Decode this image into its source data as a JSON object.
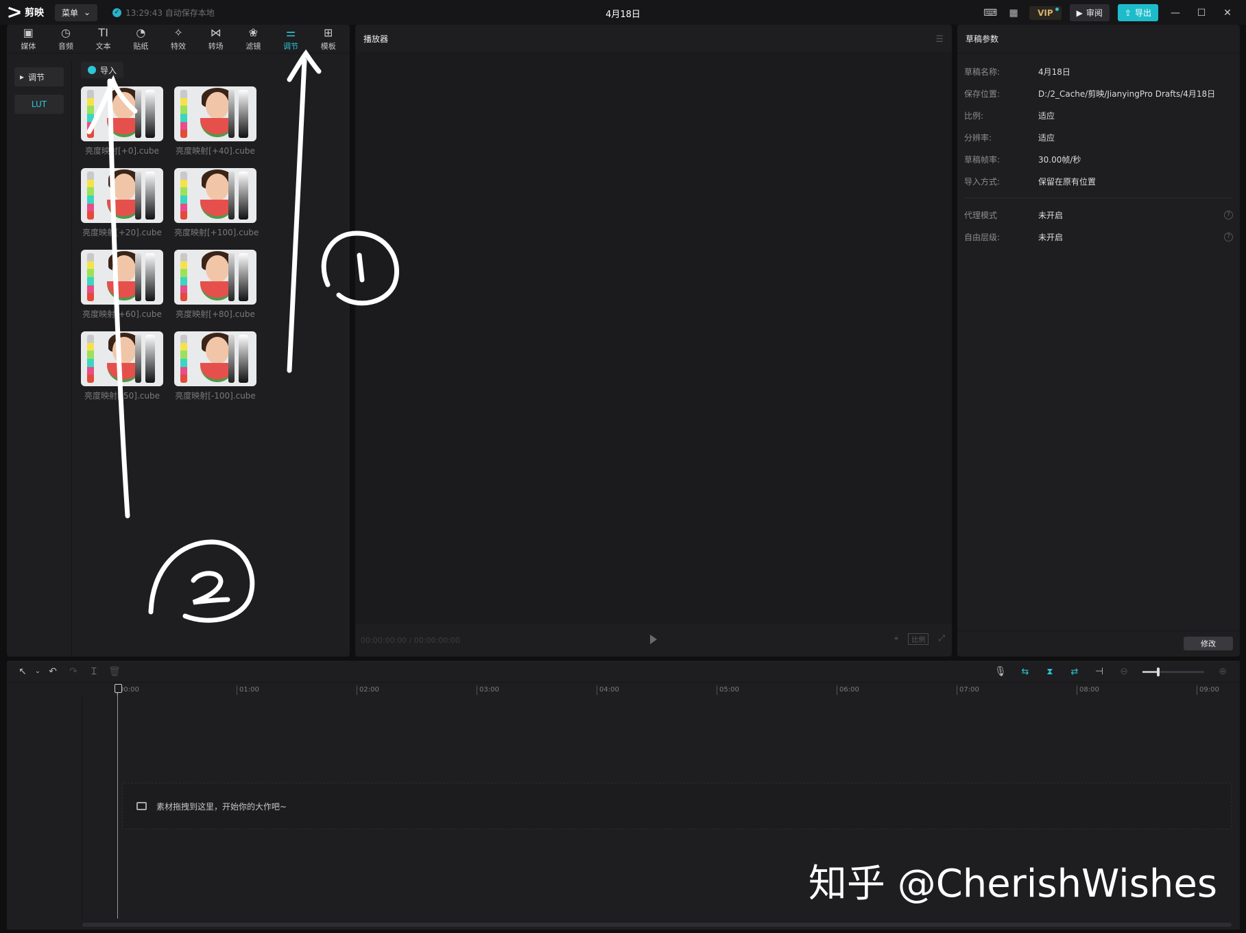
{
  "app": {
    "name": "剪映",
    "menu_label": "菜单",
    "save_status": "13:29:43 自动保存本地",
    "title": "4月18日"
  },
  "header": {
    "vip_label": "VIP",
    "review_label": "审阅",
    "export_label": "导出"
  },
  "toolbar": [
    {
      "label": "媒体",
      "icon": "media-icon"
    },
    {
      "label": "音频",
      "icon": "audio-icon"
    },
    {
      "label": "文本",
      "icon": "text-icon"
    },
    {
      "label": "贴纸",
      "icon": "sticker-icon"
    },
    {
      "label": "特效",
      "icon": "effects-icon"
    },
    {
      "label": "转场",
      "icon": "transition-icon"
    },
    {
      "label": "滤镜",
      "icon": "filter-icon"
    },
    {
      "label": "调节",
      "icon": "adjust-icon",
      "active": true
    },
    {
      "label": "模板",
      "icon": "template-icon"
    }
  ],
  "sidebar": {
    "items": [
      {
        "label": "调节"
      },
      {
        "label": "LUT",
        "active": true
      }
    ]
  },
  "lut": {
    "import_label": "导入",
    "items": [
      {
        "label": "亮度映射[+0].cube"
      },
      {
        "label": "亮度映射[+40].cube"
      },
      {
        "label": "亮度映射[+20].cube"
      },
      {
        "label": "亮度映射[+100].cube"
      },
      {
        "label": "亮度映射[+60].cube"
      },
      {
        "label": "亮度映射[+80].cube"
      },
      {
        "label": "亮度映射[-50].cube"
      },
      {
        "label": "亮度映射[-100].cube"
      }
    ]
  },
  "player": {
    "title": "播放器",
    "timecode": "00:00:00:00 / 00:00:00:00",
    "ratio_label": "比例"
  },
  "params": {
    "title": "草稿参数",
    "rows": [
      {
        "key": "草稿名称:",
        "value": "4月18日"
      },
      {
        "key": "保存位置:",
        "value": "D:/2_Cache/剪映/JianyingPro Drafts/4月18日"
      },
      {
        "key": "比例:",
        "value": "适应"
      },
      {
        "key": "分辨率:",
        "value": "适应"
      },
      {
        "key": "草稿帧率:",
        "value": "30.00帧/秒"
      },
      {
        "key": "导入方式:",
        "value": "保留在原有位置"
      }
    ],
    "extra_rows": [
      {
        "key": "代理模式",
        "value": "未开启"
      },
      {
        "key": "自由层级:",
        "value": "未开启"
      }
    ],
    "modify_label": "修改"
  },
  "timeline": {
    "ticks": [
      "00:00",
      "01:00",
      "02:00",
      "03:00",
      "04:00",
      "05:00",
      "06:00",
      "07:00",
      "08:00",
      "09:00"
    ],
    "drop_hint": "素材拖拽到这里，开始你的大作吧~",
    "zoom_level": 0.25
  },
  "watermark": "知乎 @CherishWishes",
  "colors": {
    "accent": "#2bc7d8",
    "panel": "#1e1e20",
    "background": "#0f0f10"
  }
}
